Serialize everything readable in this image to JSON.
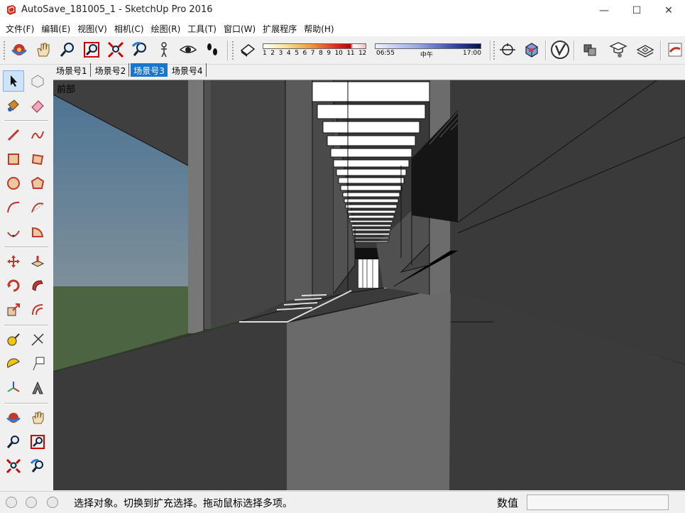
{
  "window": {
    "title": "AutoSave_181005_1 - SketchUp Pro 2016",
    "minimize": "—",
    "maximize": "☐",
    "close": "✕"
  },
  "menu": [
    "文件(F)",
    "编辑(E)",
    "视图(V)",
    "相机(C)",
    "绘图(R)",
    "工具(T)",
    "窗口(W)",
    "扩展程序",
    "帮助(H)"
  ],
  "shadow_scale": [
    "1",
    "2",
    "3",
    "4",
    "5",
    "6",
    "7",
    "8",
    "9",
    "10",
    "11",
    "12"
  ],
  "time_scale": {
    "start": "06:55",
    "mid": "中午",
    "end": "17:00"
  },
  "scenes": [
    "场景号1",
    "场景号2",
    "场景号3",
    "场景号4"
  ],
  "active_scene": "场景号3",
  "viewport": {
    "label": "前部"
  },
  "status": {
    "message": "选择对象。切换到扩充选择。拖动鼠标选择多项。",
    "measure_label": "数值",
    "measure_value": ""
  },
  "colors": {
    "accent": "#1b76c9",
    "sky": "#5a7c94",
    "grass": "#4c6440"
  }
}
